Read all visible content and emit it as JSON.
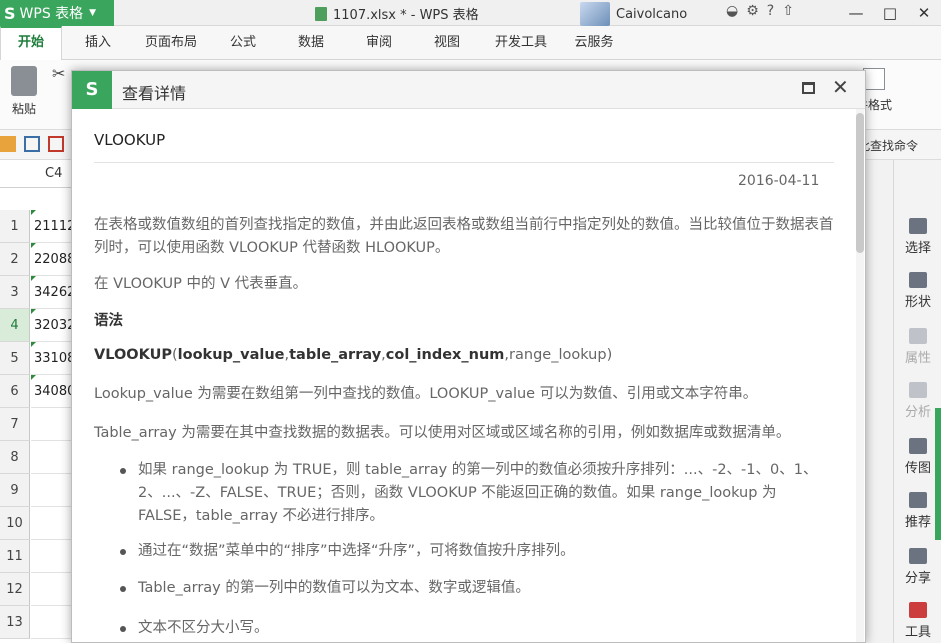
{
  "app": {
    "name": "WPS 表格",
    "logo": "S",
    "document_title": "1107.xlsx * - WPS 表格",
    "user_name": "Caivolcano",
    "window_controls": [
      "minimize-icon",
      "restore-icon",
      "close-icon"
    ]
  },
  "tabs": [
    "开始",
    "插入",
    "页面布局",
    "公式",
    "数据",
    "审阅",
    "视图",
    "开发工具",
    "云服务"
  ],
  "ribbon": {
    "paste_label": "粘贴",
    "cond_format_label": "件格式",
    "search_hint": "此查找命令"
  },
  "namebox": {
    "value": "C4"
  },
  "sheet": {
    "row_numbers": [
      "1",
      "2",
      "3",
      "4",
      "5",
      "6",
      "7",
      "8",
      "9",
      "10",
      "11",
      "12",
      "13"
    ],
    "selected_row": "4",
    "cells": [
      "21112",
      "22088",
      "34262",
      "32032",
      "33108",
      "34080",
      "",
      "",
      "",
      "",
      "",
      "",
      ""
    ]
  },
  "side_panel": {
    "items": [
      "选择",
      "形状",
      "属性",
      "分析",
      "传图",
      "推荐",
      "分享",
      "工具"
    ]
  },
  "dialog": {
    "title": "查看详情",
    "logo": "S",
    "function_name": "VLOOKUP",
    "date": "2016-04-11",
    "description": "在表格或数值数组的首列查找指定的数值，并由此返回表格或数组当前行中指定列处的数值。当比较值位于数据表首列时，可以使用函数 VLOOKUP 代替函数 HLOOKUP。",
    "v_note": "在 VLOOKUP 中的 V 代表垂直。",
    "syntax_heading": "语法",
    "syntax": {
      "fn": "VLOOKUP",
      "open": "(",
      "arg1": "lookup_value",
      "arg2": "table_array",
      "arg3": "col_index_num",
      "arg4": "range_lookup",
      "close": ")"
    },
    "lookup_value_desc": "Lookup_value  为需要在数组第一列中查找的数值。LOOKUP_value 可以为数值、引用或文本字符串。",
    "table_array_desc": "Table_array  为需要在其中查找数据的数据表。可以使用对区域或区域名称的引用，例如数据库或数据清单。",
    "bullets": [
      "如果 range_lookup 为 TRUE，则 table_array  的第一列中的数值必须按升序排列：...、-2、-1、0、1、2、...、-Z、FALSE、TRUE；否则，函数 VLOOKUP 不能返回正确的数值。如果  range_lookup 为 FALSE，table_array 不必进行排序。",
      "通过在“数据”菜单中的“排序”中选择“升序”，可将数值按升序排列。",
      "Table_array 的第一列中的数值可以为文本、数字或逻辑值。",
      "文本不区分大小写。"
    ]
  }
}
